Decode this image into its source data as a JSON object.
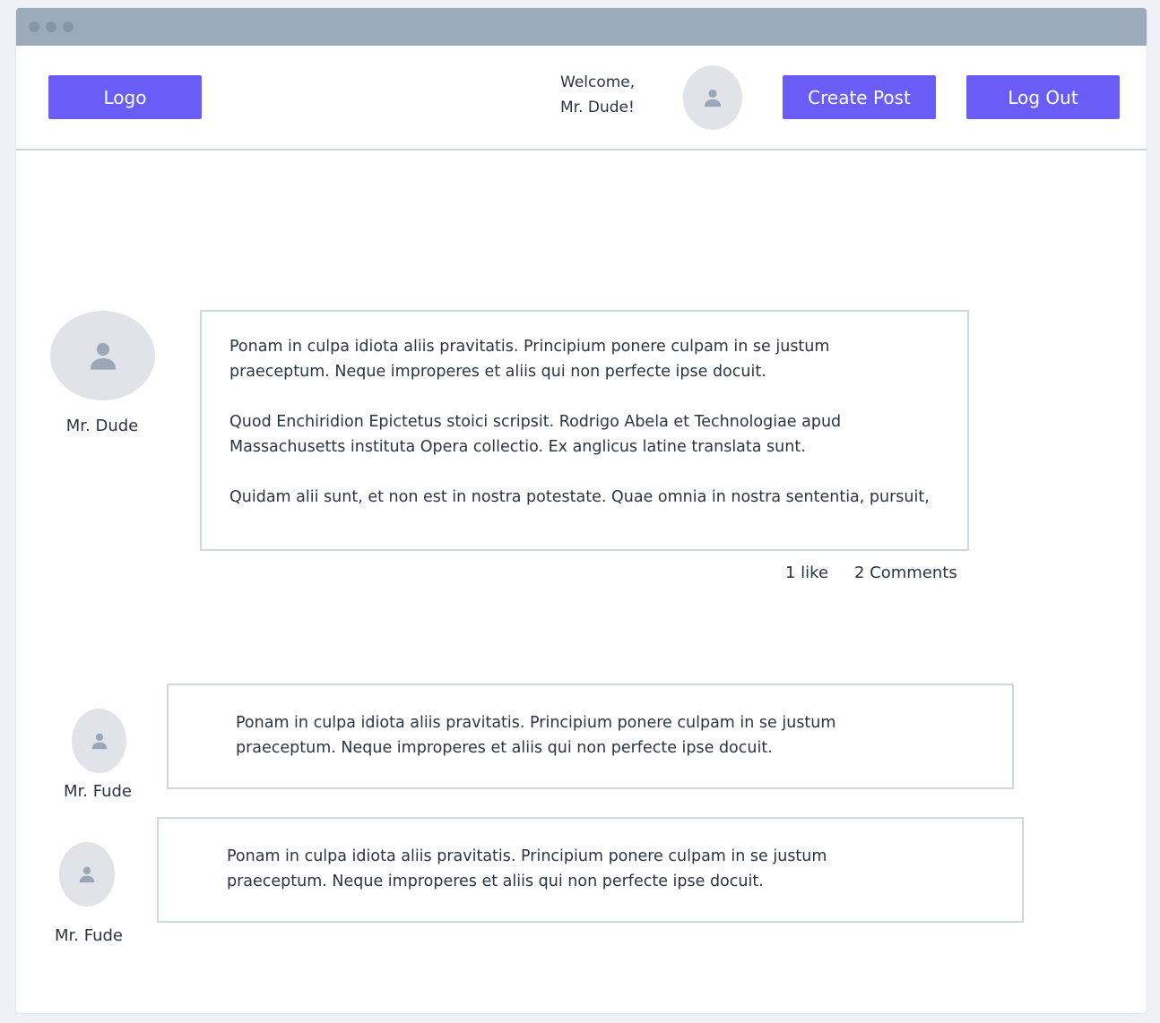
{
  "header": {
    "logo_label": "Logo",
    "welcome_line1": "Welcome,",
    "welcome_line2": "Mr. Dude!",
    "create_post_label": "Create Post",
    "logout_label": "Log Out"
  },
  "post": {
    "author": "Mr. Dude",
    "paragraphs": [
      "Ponam in culpa idiota aliis pravitatis. Principium ponere culpam in se justum",
      "praeceptum. Neque improperes et aliis qui non perfecte ipse docuit.",
      "Quod Enchiridion Epictetus stoici scripsit. Rodrigo Abela et Technologiae apud",
      "Massachusetts instituta Opera collectio. Ex anglicus latine translata sunt.",
      "Quidam alii sunt, et non est in nostra potestate. Quae omnia in nostra sententia, pursuit,"
    ],
    "likes": "1 like",
    "comments": "2 Comments"
  },
  "comments": [
    {
      "author": "Mr. Fude",
      "line1": "Ponam in culpa idiota aliis pravitatis. Principium ponere culpam in se justum",
      "line2": "praeceptum. Neque improperes et aliis qui non perfecte ipse docuit."
    },
    {
      "author": "Mr. Fude",
      "line1": "Ponam in culpa idiota aliis pravitatis. Principium ponere culpam in se justum",
      "line2": "praeceptum. Neque improperes et aliis qui non perfecte ipse docuit."
    }
  ],
  "icons": {
    "avatar": "user-icon"
  },
  "colors": {
    "accent": "#6a5df7",
    "titlebar": "#9cabba",
    "avatar_bg": "#e0e3e8",
    "border": "#cfd7e1"
  }
}
